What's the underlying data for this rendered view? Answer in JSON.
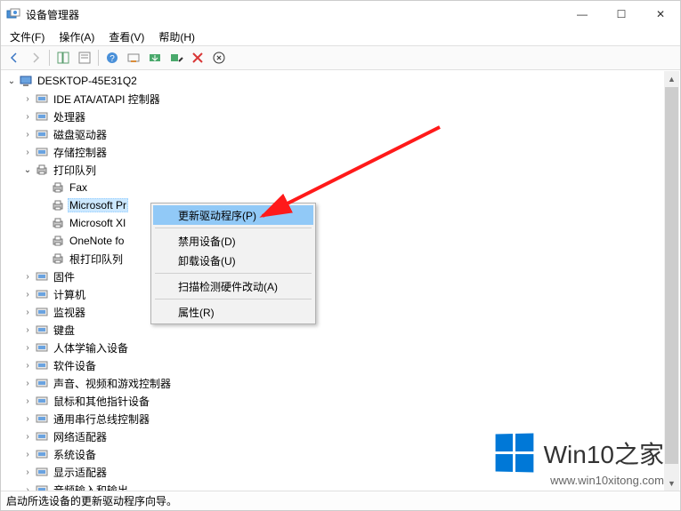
{
  "window": {
    "title": "设备管理器",
    "min": "—",
    "max": "☐",
    "close": "✕"
  },
  "menu": {
    "file": "文件(F)",
    "action": "操作(A)",
    "view": "查看(V)",
    "help": "帮助(H)"
  },
  "root": "DESKTOP-45E31Q2",
  "cats": [
    {
      "label": "IDE ATA/ATAPI 控制器",
      "expanded": false
    },
    {
      "label": "处理器",
      "expanded": false
    },
    {
      "label": "磁盘驱动器",
      "expanded": false
    },
    {
      "label": "存储控制器",
      "expanded": false
    },
    {
      "label": "打印队列",
      "expanded": true
    },
    {
      "label": "固件",
      "expanded": false
    },
    {
      "label": "计算机",
      "expanded": false
    },
    {
      "label": "监视器",
      "expanded": false
    },
    {
      "label": "键盘",
      "expanded": false
    },
    {
      "label": "人体学输入设备",
      "expanded": false
    },
    {
      "label": "软件设备",
      "expanded": false
    },
    {
      "label": "声音、视频和游戏控制器",
      "expanded": false
    },
    {
      "label": "鼠标和其他指针设备",
      "expanded": false
    },
    {
      "label": "通用串行总线控制器",
      "expanded": false
    },
    {
      "label": "网络适配器",
      "expanded": false
    },
    {
      "label": "系统设备",
      "expanded": false
    },
    {
      "label": "显示适配器",
      "expanded": false
    },
    {
      "label": "音频输入和输出",
      "expanded": false
    }
  ],
  "printers": [
    {
      "label": "Fax"
    },
    {
      "label": "Microsoft Pr"
    },
    {
      "label": "Microsoft XI"
    },
    {
      "label": "OneNote fo"
    },
    {
      "label": "根打印队列"
    }
  ],
  "selected_printer_index": 1,
  "context": {
    "items": [
      "更新驱动程序(P)",
      "禁用设备(D)",
      "卸载设备(U)",
      "扫描检测硬件改动(A)",
      "属性(R)"
    ],
    "highlighted": 0
  },
  "status": "启动所选设备的更新驱动程序向导。",
  "watermark": {
    "brand": "Win10之家",
    "url": "www.win10xitong.com"
  }
}
